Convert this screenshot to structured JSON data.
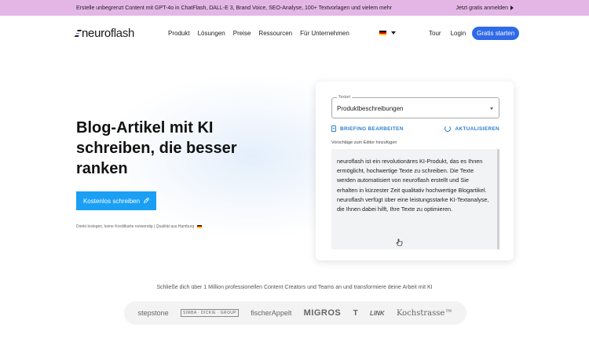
{
  "topbar": {
    "promo": "Erstelle unbegrenzt Content mit GPT-4o in ChatFlash, DALL-E 3, Brand Voice, SEO-Analyse, 100+ Textvorlagen und vielem mehr",
    "cta": "Jetzt gratis anmelden",
    "bg_color": "#e4b6e6"
  },
  "nav": {
    "logo": "neuroflash",
    "logo_part1": "neuro",
    "logo_part2": "flash",
    "items": [
      "Produkt",
      "Lösungen",
      "Preise",
      "Ressourcen",
      "Für Unternehmen"
    ],
    "language_icon": "german-flag-icon",
    "tour": "Tour",
    "login": "Login",
    "signup": "Gratis starten",
    "accent_color": "#2f6ae8"
  },
  "hero": {
    "title": "Blog-Artikel mit KI schreiben, die besser ranken",
    "cta": "Kostenlos schreiben",
    "cta_icon": "rocket-icon",
    "cta_color": "#1a9ff5",
    "note": "Direkt loslegen, keine Kreditkarte notwendig | Qualität aus Hamburg"
  },
  "card": {
    "select_label": "Textart",
    "select_value": "Produktbeschreibungen",
    "briefing": "BRIEFING BEARBEITEN",
    "refresh": "AKTUALISIEREN",
    "hint": "Vorschläge zum Editor hinzufügen",
    "text": "neuroflash ist ein revolutionäres KI-Produkt, das es Ihnen ermöglicht, hochwertige Texte zu schreiben. Die Texte werden automatisiert von neuroflash erstellt und Sie erhalten in kürzester Zeit qualitativ hochwertige Blogartikel. neuroflash verfügt über eine leistungsstarke KI-Textanalyse, die Ihnen dabei hilft, Ihre Texte zu optimieren."
  },
  "trust": {
    "text": "Schließe dich über 1 Million professionellen Content Creators und Teams an und transformiere deine Arbeit mit KI",
    "logos": [
      "stepstone",
      "SIMBA · DICKIE · GROUP",
      "fischerAppelt",
      "MIGROS",
      "T",
      "LINK",
      "Kochstrasse™"
    ]
  }
}
